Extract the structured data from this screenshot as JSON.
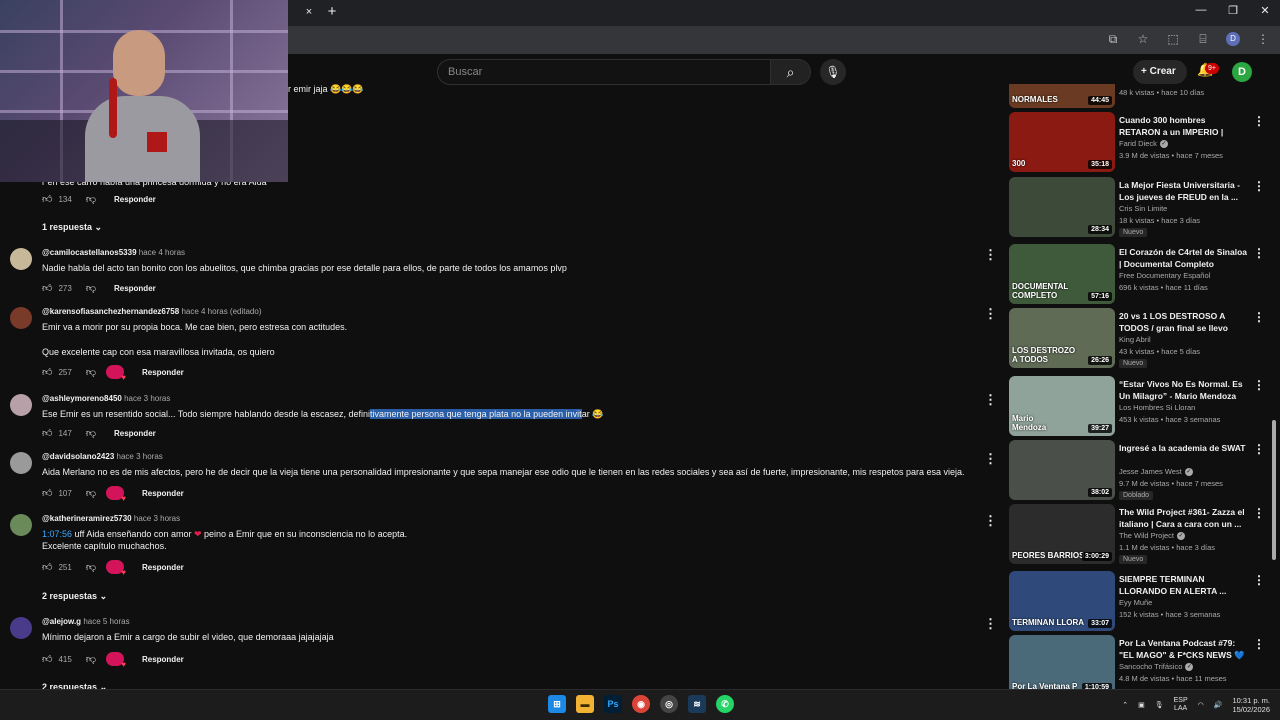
{
  "search": {
    "placeholder": "Buscar"
  },
  "header": {
    "crear": "Crear",
    "notifications": "9+",
    "avatar": "D"
  },
  "tab_close": "×",
  "webcam_overlap_text": "r emir jaja 😂😂😂",
  "partial_comment": {
    "text": "r en ese carro había una princesa dormida y no era Aida",
    "likes": "134",
    "reply": "Responder",
    "replies": "1 respuesta"
  },
  "comments": [
    {
      "user": "@camilocastellanos5339",
      "time": "hace 4 horas",
      "lines": [
        "Nadie habla del acto tan bonito con los abuelitos, que chimba gracias por ese detalle para ellos, de parte de todos los amamos plvp"
      ],
      "likes": "273",
      "reply": "Responder"
    },
    {
      "user": "@karensofiasanchezhernandez6758",
      "time": "hace 4 horas (editado)",
      "lines": [
        "Emir va a morir por su propia boca. Me cae bien, pero estresa con actitudes.",
        "Que excelente cap con esa maravillosa invitada, os quiero"
      ],
      "likes": "257",
      "reply": "Responder"
    },
    {
      "user": "@ashleymoreno8450",
      "time": "hace 3 horas",
      "text_before": "Ese Emir es un resentido social... Todo siempre hablando desde la escasez, defini",
      "text_selected": "tivamente persona que tenga plata no la pueden invit",
      "text_after": "ar 😂",
      "likes": "147",
      "reply": "Responder"
    },
    {
      "user": "@davidsolano2423",
      "time": "hace 3 horas",
      "lines": [
        "Aida Merlano no es de mis afectos, pero he de decir que la vieja tiene una personalidad impresionante y que sepa manejar ese odio que le tienen en las redes sociales y sea así de fuerte, impresionante, mis respetos para esa vieja."
      ],
      "likes": "107",
      "reply": "Responder"
    },
    {
      "user": "@katherineramirez5730",
      "time": "hace 3 horas",
      "timestamp": "1:07:56",
      "text_a": " uff Aida enseñando con amor ",
      "text_b": " peino a Emir que en su inconsciencia no lo acepta.",
      "line2": "Excelente capítulo muchachos.",
      "likes": "251",
      "reply": "Responder",
      "replies": "2 respuestas"
    },
    {
      "user": "@alejow.g",
      "time": "hace 5 horas",
      "lines": [
        "Mínimo dejaron a Emir a cargo de subir el video, que demoraaa jajajajaja"
      ],
      "likes": "415",
      "reply": "Responder",
      "replies": "2 respuestas"
    }
  ],
  "sidebar": [
    {
      "title": "",
      "channel": "",
      "meta": "48 k vistas • hace 10 días",
      "duration": "44:45",
      "thumb_text": "NORMALES",
      "color": "#6a3b22"
    },
    {
      "title": "Cuando 300 hombres RETARON a un IMPERIO | Relato y ...",
      "channel": "Farid Dieck",
      "verified": true,
      "meta": "3.9 M de vistas • hace 7 meses",
      "duration": "35:18",
      "thumb_text": "300",
      "color": "#8a1a12"
    },
    {
      "title": "La Mejor Fiesta Universitaria - Los jueves de FREUD en la ...",
      "channel": "Cris Sin Limite",
      "meta": "18 k vistas • hace 3 días",
      "badge": "Nuevo",
      "duration": "28:34",
      "thumb_text": "",
      "color": "#3d4a3a"
    },
    {
      "title": "El Corazón de C4rtel de Sinaloa | Documental Completo",
      "channel": "Free Documentary Español",
      "meta": "696 k vistas • hace 11 días",
      "duration": "57:16",
      "thumb_text": "DOCUMENTAL\nCOMPLETO",
      "color": "#3f5a3a"
    },
    {
      "title": "20 vs 1 LOS DESTROSO A TODOS / gran final se llevo tod...",
      "channel": "King Abril",
      "meta": "43 k vistas • hace 5 días",
      "badge": "Nuevo",
      "duration": "26:26",
      "thumb_text": "LOS DESTROZO\nA TODOS",
      "color": "#5f6b55"
    },
    {
      "title": "“Estar Vivos No Es Normal. Es Un Milagro” - Mario Mendoza",
      "channel": "Los Hombres Si Lloran",
      "meta": "453 k vistas • hace 3 semanas",
      "duration": "39:27",
      "thumb_text": "Mario\nMendoza",
      "color": "#8fa39a"
    },
    {
      "title": "Ingresé a la academia de SWAT",
      "channel": "Jesse James West",
      "verified": true,
      "meta": "9.7 M de vistas • hace 7 meses",
      "badge": "Doblado",
      "duration": "38:02",
      "thumb_text": "",
      "color": "#4a4f4a"
    },
    {
      "title": "The Wild Project #361- Zazza el italiano | Cara a cara con un ...",
      "channel": "The Wild Project",
      "verified": true,
      "meta": "1.1 M de vistas • hace 3 días",
      "badge": "Nuevo",
      "duration": "3:00:29",
      "thumb_text": "PEORES BARRIOS",
      "color": "#2c2c2c"
    },
    {
      "title": "SIEMPRE TERMINAN LLORANDO EN ALERTA ...",
      "channel": "Eyy Muñe",
      "meta": "152 k vistas • hace 3 semanas",
      "duration": "33:07",
      "thumb_text": "TERMINAN LLORA",
      "color": "#2f4a7a"
    },
    {
      "title": "Por La Ventana Podcast #79: \"EL MAGO\" & F*CKS NEWS 💙 ...",
      "channel": "Sancocho Trifásico",
      "verified": true,
      "meta": "4.8 M de vistas • hace 11 meses",
      "duration": "1:10:59",
      "thumb_text": "Por La Ventana P",
      "color": "#4a6a7a"
    }
  ],
  "taskbar": {
    "lang1": "ESP",
    "lang2": "LAA",
    "time": "10:31 p. m.",
    "date": "15/02/2026"
  }
}
